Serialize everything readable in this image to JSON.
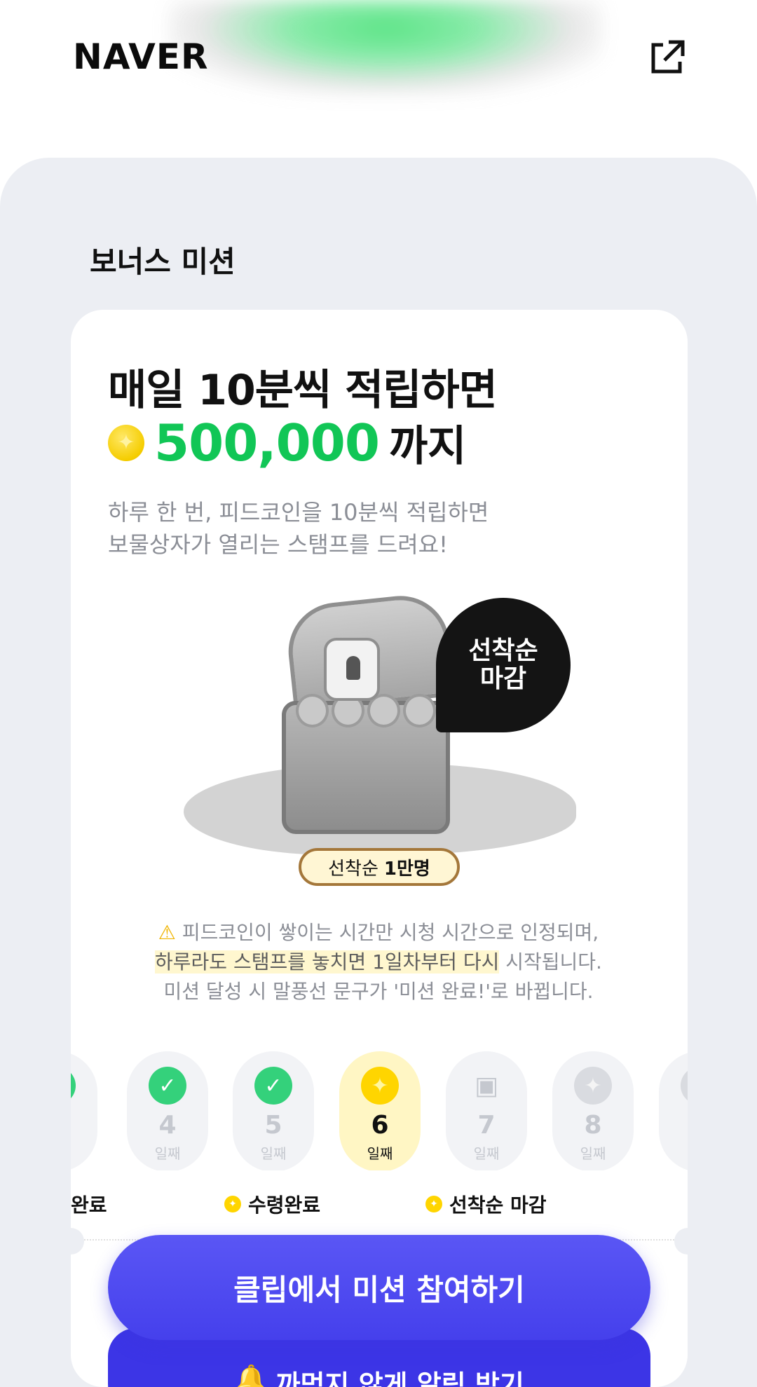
{
  "header": {
    "logo": "NAVER",
    "share_icon": "external-link-icon"
  },
  "section": {
    "title": "보너스 미션"
  },
  "mission": {
    "headline": "매일 10분씩 적립하면",
    "amount": "500,000",
    "amount_suffix": "까지",
    "coin_icon": "coin-icon",
    "desc_line1": "하루 한 번, 피드코인을 10분씩 적립하면",
    "desc_line2": "보물상자가 열리는 스탬프를 드려요!",
    "badge_line1": "선착순",
    "badge_line2": "마감",
    "first_come_label": "선착순",
    "first_come_value": "1만명"
  },
  "notice": {
    "line1": "피드코인이 쌓이는 시간만 시청 시간으로 인정되며,",
    "line2_highlight": "하루라도 스탬프를 놓치면 1일차부터 다시",
    "line2_rest": " 시작됩니다.",
    "line3": "미션 달성 시 말풍선 문구가 '미션 완료!'로 바뀝니다."
  },
  "days": [
    {
      "num": "4",
      "label": "일째",
      "state": "done"
    },
    {
      "num": "5",
      "label": "일째",
      "state": "done"
    },
    {
      "num": "6",
      "label": "일째",
      "state": "today"
    },
    {
      "num": "7",
      "label": "일째",
      "state": "future-chest"
    },
    {
      "num": "8",
      "label": "일째",
      "state": "future"
    }
  ],
  "legend": {
    "done": "완료",
    "received": "수령완료",
    "closed": "선착순 마감"
  },
  "buttons": {
    "join": "클립에서 미션 참여하기",
    "notify": "까먹지 않게 알림 받기"
  },
  "colors": {
    "accent_green": "#11c656",
    "cta_purple": "#4540ec",
    "coin_yellow": "#ffd500"
  }
}
